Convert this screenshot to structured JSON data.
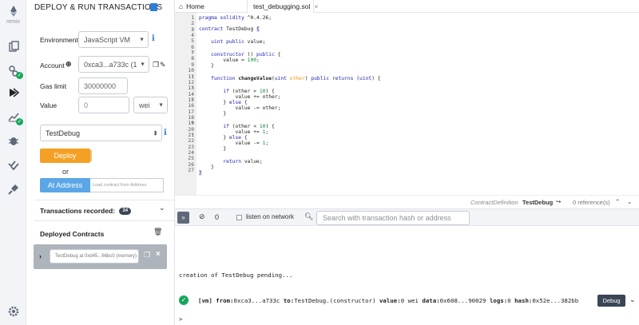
{
  "rail": {
    "logo_text": "remix",
    "icons": [
      "remix-logo-icon",
      "file-explorer-icon",
      "solidity-compiler-icon",
      "deploy-run-icon",
      "analysis-icon",
      "debugger-icon",
      "tests-icon",
      "plugin-manager-icon",
      "settings-icon"
    ]
  },
  "panel": {
    "title": "DEPLOY & RUN TRANSACTIONS",
    "environment_label": "Environment",
    "environment_value": "JavaScript VM",
    "account_label": "Account",
    "account_value": "0xca3...a733c (1",
    "gas_label": "Gas limit",
    "gas_value": "30000000",
    "value_label": "Value",
    "value_value": "0",
    "value_unit": "wei",
    "contract_value": "TestDebug",
    "deploy_label": "Deploy",
    "or_label": "or",
    "at_address_label": "At Address",
    "at_address_placeholder": "Load contract from Address",
    "tx_recorded_label": "Transactions recorded:",
    "tx_recorded_count": "34",
    "deployed_label": "Deployed Contracts",
    "instance_label": "TestDebug at 0xd45...66bc0 (memory)"
  },
  "tabs": {
    "home": "Home",
    "file": "test_debugging.sol"
  },
  "editor": {
    "line_numbers": [
      "1",
      "2",
      "3",
      "4",
      "5",
      "6",
      "7",
      "8",
      "9",
      "10",
      "11",
      "12",
      "13",
      "14",
      "15",
      "16",
      "17",
      "18",
      "19",
      "20",
      "21",
      "22",
      "23",
      "24",
      "25",
      "26",
      "27"
    ]
  },
  "status_strip": {
    "definition_label": "ContractDefinition",
    "definition_name": "TestDebug",
    "references": "0 reference(s)"
  },
  "terminal": {
    "count": "0",
    "listen_label": "listen on network",
    "search_placeholder": "Search with transaction hash or address",
    "pending_text": "creation of TestDebug pending...",
    "tx_tag": "[vm]",
    "from_label": "from:",
    "from_value": "0xca3...a733c",
    "to_label": "to:",
    "to_value": "TestDebug.(constructor)",
    "value_label": "value:",
    "value_value": "0 wei",
    "data_label": "data:",
    "data_value": "0x608...90029",
    "logs_label": "logs:",
    "logs_value": "0",
    "hash_label": "hash:",
    "hash_value": "0x52e...382bb",
    "debug_label": "Debug",
    "prompt": ">"
  }
}
